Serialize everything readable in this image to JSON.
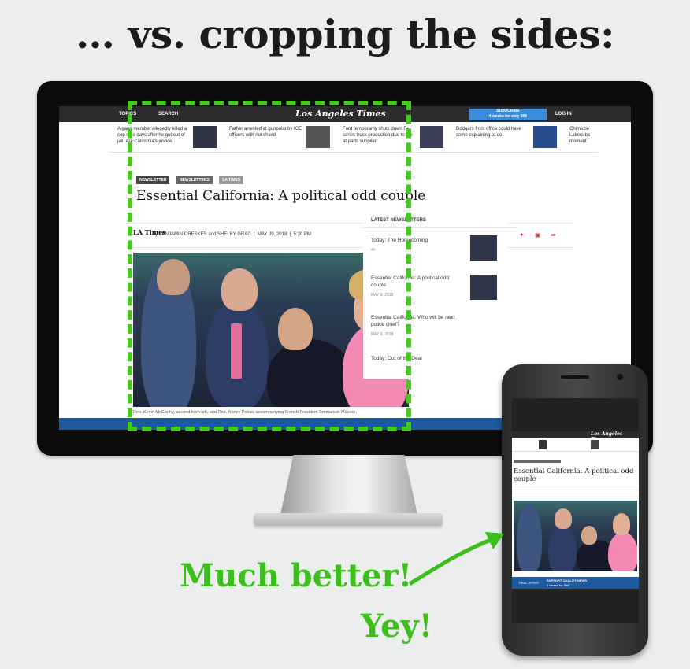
{
  "headline": "… vs. cropping the sides:",
  "site": {
    "topics": "TOPICS",
    "search": "SEARCH",
    "logo": "Los Angeles Times",
    "subscribe_title": "SUBSCRIBE",
    "subscribe_sub": "4 weeks for only 99¢",
    "login": "LOG IN"
  },
  "rail": [
    "A gang member allegedly killed a cop nine days after he got out of jail. Are California's justice…",
    "Father arrested at gunpoint by ICE officers with riot shield",
    "Ford temporarily shuts down F-series truck production due to fire at parts supplier",
    "Dodgers front office could have some explaining to do",
    "Chimezie Lakers be moment"
  ],
  "article": {
    "tags": [
      "NEWSLETTER",
      "NEWSLETTERS",
      "LA TIMES"
    ],
    "title": "Essential California: A political odd couple",
    "la_mark": "LA Times",
    "byline": "By BENJAMIN ORESKES and SHELBY GRAD",
    "date": "MAY 09, 2018",
    "time": "5:30 PM",
    "caption": "Rep. Kevin McCarthy, second from left, and Rep. Nancy Pelosi, accompanying French President Emmanuel Macron,"
  },
  "sidebar": {
    "header": "LATEST NEWSLETTERS",
    "items": [
      {
        "title": "Today: The Homecoming",
        "date": "4h"
      },
      {
        "title": "Essential California: A political odd couple",
        "date": "MAY 9, 2018"
      },
      {
        "title": "Essential California: Who will be next police chief?",
        "date": "MAY 9, 2018"
      },
      {
        "title": "Today: Out of the Deal",
        "date": ""
      }
    ]
  },
  "phone": {
    "logo": "Los Angeles Times",
    "title": "Essential California: A political odd couple",
    "banner_left": "TRIAL OFFER",
    "banner_mid": "SUPPORT QUALITY NEWS",
    "banner_sub": "4 weeks for 99¢"
  },
  "much_better": "Much better!",
  "yey": "Yey!",
  "colors": {
    "accent_green": "#3cbf1d",
    "subscribe_blue": "#3b8ddc",
    "banner_blue": "#1e5aa0"
  }
}
